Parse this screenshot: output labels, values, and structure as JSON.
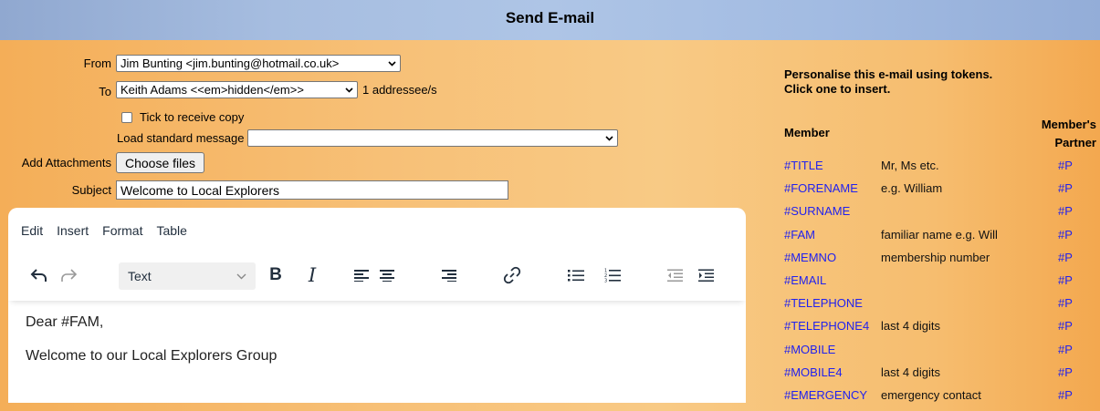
{
  "header": {
    "title": "Send E-mail"
  },
  "form": {
    "from_label": "From",
    "from_value": "Jim Bunting <jim.bunting@hotmail.co.uk>",
    "to_label": "To",
    "to_value": "Keith Adams <<em>hidden</em>>",
    "addressee_count": "1 addressee/s",
    "copy_label": "Tick to receive copy",
    "copy_checked": false,
    "standard_message_label": "Load standard message",
    "standard_message_value": "",
    "attachments_label": "Add Attachments",
    "choose_files_label": "Choose files",
    "subject_label": "Subject",
    "subject_value": "Welcome to Local Explorers"
  },
  "editor": {
    "menu": [
      "Edit",
      "Insert",
      "Format",
      "Table"
    ],
    "format_select_value": "Text",
    "toolbar_icons": [
      "undo-icon",
      "redo-icon",
      "bold-icon",
      "italic-icon",
      "align-left-icon",
      "align-center-icon",
      "align-right-icon",
      "link-icon",
      "bullet-list-icon",
      "numbered-list-icon",
      "outdent-icon",
      "indent-icon"
    ],
    "bold_label": "B",
    "italic_label": "I",
    "paragraphs": [
      "Dear #FAM,",
      "Welcome to our Local Explorers Group"
    ]
  },
  "tokens": {
    "heading_line1": "Personalise this e-mail using tokens.",
    "heading_line2": "Click one to insert.",
    "member_header": "Member",
    "partner_header_line1": "Member's",
    "partner_header_line2": "Partner",
    "link_color": "#2222ee",
    "rows": [
      {
        "token": "#TITLE",
        "desc": "Mr, Ms etc.",
        "partner": "#P"
      },
      {
        "token": "#FORENAME",
        "desc": "e.g. William",
        "partner": "#P"
      },
      {
        "token": "#SURNAME",
        "desc": "",
        "partner": "#P"
      },
      {
        "token": "#FAM",
        "desc": "familiar name e.g. Will",
        "partner": "#P"
      },
      {
        "token": "#MEMNO",
        "desc": "membership number",
        "partner": "#P"
      },
      {
        "token": "#EMAIL",
        "desc": "",
        "partner": "#P"
      },
      {
        "token": "#TELEPHONE",
        "desc": "",
        "partner": "#P"
      },
      {
        "token": "#TELEPHONE4",
        "desc": "last 4 digits",
        "partner": "#P"
      },
      {
        "token": "#MOBILE",
        "desc": "",
        "partner": "#P"
      },
      {
        "token": "#MOBILE4",
        "desc": "last 4 digits",
        "partner": "#P"
      },
      {
        "token": "#EMERGENCY",
        "desc": "emergency contact",
        "partner": "#P"
      }
    ]
  }
}
